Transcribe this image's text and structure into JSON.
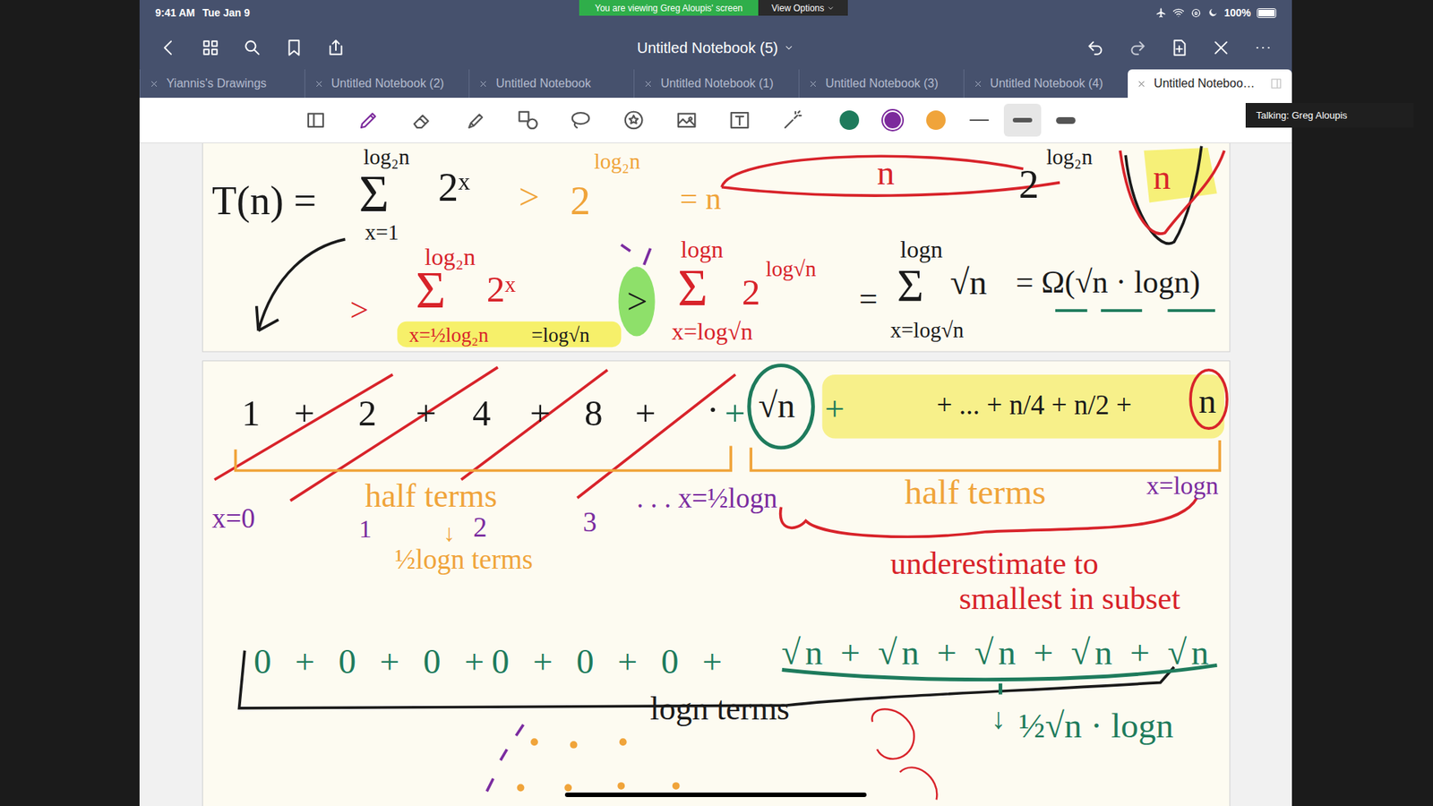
{
  "zoom": {
    "banner": "You are viewing Greg Aloupis' screen",
    "view_options": "View Options",
    "talking": "Talking: Greg Aloupis"
  },
  "status_bar": {
    "time": "9:41 AM",
    "date": "Tue Jan 9",
    "battery": "100%",
    "battery_level": 1
  },
  "window": {
    "title": "Untitled Notebook (5)"
  },
  "tabs": [
    {
      "label": "Yiannis's Drawings",
      "selected": false
    },
    {
      "label": "Untitled Notebook (2)",
      "selected": false
    },
    {
      "label": "Untitled Notebook",
      "selected": false
    },
    {
      "label": "Untitled Notebook (1)",
      "selected": false
    },
    {
      "label": "Untitled Notebook (3)",
      "selected": false
    },
    {
      "label": "Untitled Notebook (4)",
      "selected": false
    },
    {
      "label": "Untitled Noteboo…",
      "selected": true
    }
  ],
  "tools": [
    {
      "selected": false
    },
    {
      "selected": true
    },
    {
      "selected": false
    },
    {
      "selected": false
    },
    {
      "selected": false
    },
    {
      "selected": false
    },
    {
      "selected": false
    },
    {
      "selected": false
    },
    {
      "selected": false
    },
    {
      "selected": false
    }
  ],
  "pen_colors": [
    {
      "color": "#1e7b5c",
      "selected": false
    },
    {
      "color": "#7c2a9c",
      "selected": true
    },
    {
      "color": "#f0a43a",
      "selected": false
    }
  ],
  "stroke_widths": [
    {
      "selected": false
    },
    {
      "selected": true
    },
    {
      "selected": false
    }
  ],
  "ink": [
    {
      "text": "T(n) =",
      "color": "#1a1a1a"
    },
    {
      "text": "log₂n",
      "color": "#1a1a1a"
    },
    {
      "text": "Σ",
      "color": "#1a1a1a"
    },
    {
      "text": "x=1",
      "color": "#1a1a1a"
    },
    {
      "text": "2ˣ",
      "color": "#1a1a1a"
    },
    {
      "text": ">",
      "color": "#f0a43a"
    },
    {
      "text": "2",
      "color": "#f0a43a"
    },
    {
      "text": "log₂n",
      "color": "#f0a43a"
    },
    {
      "text": "= n",
      "color": "#f0a43a"
    },
    {
      "text": "n",
      "color": "#d8232a"
    },
    {
      "text": "2",
      "color": "#1a1a1a"
    },
    {
      "text": "log₂n",
      "color": "#1a1a1a"
    },
    {
      "text": "n",
      "color": "#d8232a"
    },
    {
      "text": ">",
      "color": "#d8232a"
    },
    {
      "text": "log₂n",
      "color": "#d8232a"
    },
    {
      "text": "Σ",
      "color": "#d8232a"
    },
    {
      "text": "2ˣ",
      "color": "#d8232a"
    },
    {
      "text": "x=½log₂n",
      "color": "#d8232a"
    },
    {
      "text": "=log√n",
      "color": "#1a1a1a"
    },
    {
      "text": ">",
      "color": "#1a1a1a"
    },
    {
      "text": "logn",
      "color": "#d8232a"
    },
    {
      "text": "Σ",
      "color": "#d8232a"
    },
    {
      "text": "2",
      "color": "#d8232a"
    },
    {
      "text": "log√n",
      "color": "#d8232a"
    },
    {
      "text": "x=log√n",
      "color": "#d8232a"
    },
    {
      "text": "=",
      "color": "#1a1a1a"
    },
    {
      "text": "logn",
      "color": "#1a1a1a"
    },
    {
      "text": "Σ",
      "color": "#1a1a1a"
    },
    {
      "text": "√n",
      "color": "#1a1a1a"
    },
    {
      "text": "x=log√n",
      "color": "#1a1a1a"
    },
    {
      "text": "= Ω(√n · logn)",
      "color": "#1a1a1a"
    },
    {
      "text": "1",
      "color": "#1a1a1a"
    },
    {
      "text": "+",
      "color": "#1a1a1a"
    },
    {
      "text": "2",
      "color": "#1a1a1a"
    },
    {
      "text": "+",
      "color": "#1a1a1a"
    },
    {
      "text": "4",
      "color": "#1a1a1a"
    },
    {
      "text": "+",
      "color": "#1a1a1a"
    },
    {
      "text": "8",
      "color": "#1a1a1a"
    },
    {
      "text": "+",
      "color": "#1a1a1a"
    },
    {
      "text": "·",
      "color": "#1a1a1a"
    },
    {
      "text": "+",
      "color": "#1e7b5c"
    },
    {
      "text": "√n",
      "color": "#1a1a1a"
    },
    {
      "text": "+",
      "color": "#1e7b5c"
    },
    {
      "text": "+ ... + n/4 + n/2 +",
      "color": "#1a1a1a"
    },
    {
      "text": "n",
      "color": "#1a1a1a"
    },
    {
      "text": "x=0",
      "color": "#7b2ca0"
    },
    {
      "text": "half terms",
      "color": "#f0a43a"
    },
    {
      "text": "1",
      "color": "#7b2ca0"
    },
    {
      "text": "2",
      "color": "#7b2ca0"
    },
    {
      "text": "3",
      "color": "#7b2ca0"
    },
    {
      "text": ". . . x=½logn",
      "color": "#7b2ca0"
    },
    {
      "text": "↓",
      "color": "#f0a43a"
    },
    {
      "text": "½logn terms",
      "color": "#f0a43a"
    },
    {
      "text": "half terms",
      "color": "#f0a43a"
    },
    {
      "text": "x=logn",
      "color": "#7b2ca0"
    },
    {
      "text": "underestimate to",
      "color": "#d8232a"
    },
    {
      "text": "smallest in subset",
      "color": "#d8232a"
    },
    {
      "text": "0 + 0 + 0 +0 + 0 + 0 +",
      "color": "#1e7b5c"
    },
    {
      "text": "√n + √n + √n + √n + √n",
      "color": "#1e7b5c"
    },
    {
      "text": "logn terms",
      "color": "#1a1a1a"
    },
    {
      "text": "↓",
      "color": "#1e7b5c"
    },
    {
      "text": "½√n · logn",
      "color": "#1e7b5c"
    }
  ]
}
